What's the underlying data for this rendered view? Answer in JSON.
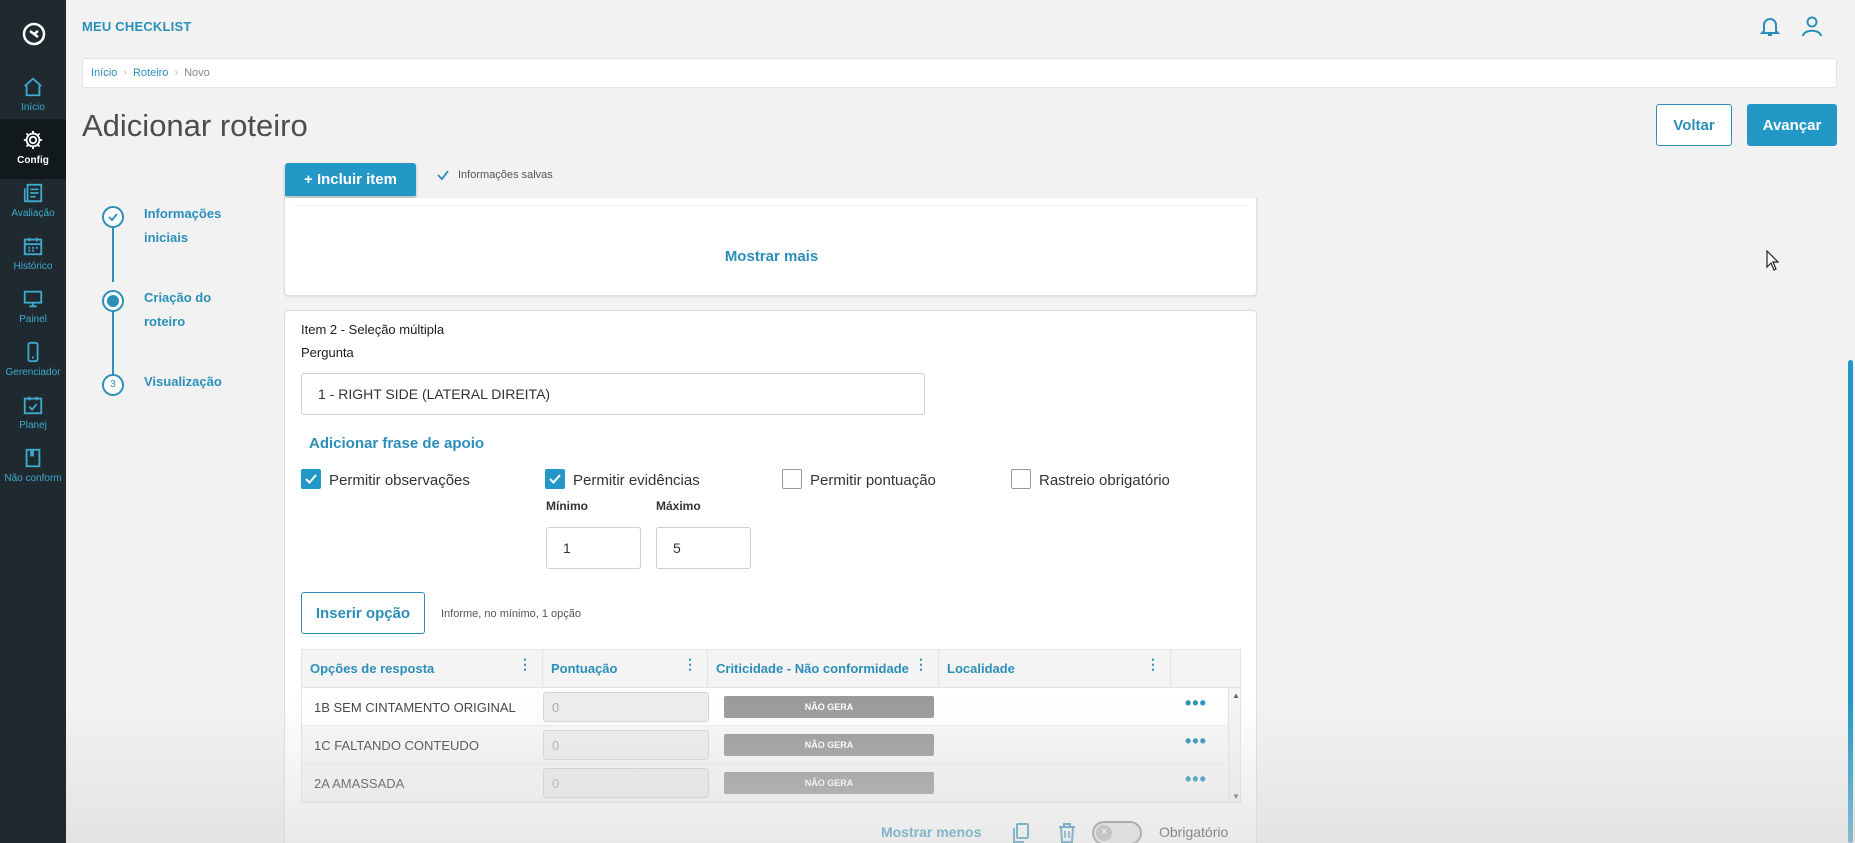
{
  "app": {
    "title": "MEU CHECKLIST"
  },
  "sidebar": {
    "items": [
      {
        "label": "Início",
        "icon": "home-icon"
      },
      {
        "label": "Config",
        "icon": "gear-icon",
        "active": true
      },
      {
        "label": "Avaliação",
        "icon": "evaluation-icon"
      },
      {
        "label": "Histórico",
        "icon": "calendar-icon"
      },
      {
        "label": "Painel",
        "icon": "monitor-icon"
      },
      {
        "label": "Gerenciador",
        "icon": "mobile-icon"
      },
      {
        "label": "Planej",
        "icon": "calendar-check-icon"
      },
      {
        "label": "Não conform",
        "icon": "book-icon"
      }
    ]
  },
  "breadcrumb": [
    "Início",
    "Roteiro",
    "Novo"
  ],
  "page": {
    "title": "Adicionar roteiro",
    "back_label": "Voltar",
    "next_label": "Avançar"
  },
  "stepper": {
    "steps": [
      {
        "label": "Informações iniciais",
        "state": "done",
        "number": ""
      },
      {
        "label": "Criação do roteiro",
        "state": "current",
        "number": ""
      },
      {
        "label": "Visualização",
        "state": "pending",
        "number": "3"
      }
    ]
  },
  "toolbar": {
    "include_item_label": "Incluir item",
    "saved_status": "Informações salvas"
  },
  "previous_item": {
    "show_more_label": "Mostrar mais"
  },
  "item": {
    "title": "Item 2 - Seleção múltipla",
    "question_label": "Pergunta",
    "question_value": "1 - RIGHT SIDE (LATERAL DIREITA)",
    "add_phrase_label": "Adicionar frase de apoio",
    "options": {
      "allow_observations": {
        "label": "Permitir observações",
        "checked": true
      },
      "allow_evidence": {
        "label": "Permitir evidências",
        "checked": true
      },
      "allow_score": {
        "label": "Permitir pontuação",
        "checked": false
      },
      "mandatory_tracking": {
        "label": "Rastreio obrigatório",
        "checked": false
      }
    },
    "min_label": "Mínimo",
    "min_value": "1",
    "max_label": "Máximo",
    "max_value": "5",
    "insert_option_label": "Inserir opção",
    "insert_hint": "Informe, no mínimo, 1 opção",
    "grid": {
      "columns": [
        "Opções de resposta",
        "Pontuação",
        "Criticidade - Não conformidade",
        "Localidade"
      ],
      "rows": [
        {
          "option": "1B SEM CINTAMENTO ORIGINAL",
          "score": "0",
          "criticality": "NÃO GERA",
          "location": ""
        },
        {
          "option": "1C FALTANDO CONTEUDO",
          "score": "0",
          "criticality": "NÃO GERA",
          "location": ""
        },
        {
          "option": "2A AMASSADA",
          "score": "0",
          "criticality": "NÃO GERA",
          "location": ""
        }
      ]
    },
    "show_less_label": "Mostrar menos",
    "required_label": "Obrigatório",
    "required_on": false
  },
  "colors": {
    "primary": "#2397c6",
    "link": "#2b8fba",
    "sidebar_bg": "#1f2a30",
    "badge_grey": "#9a9a9a"
  }
}
